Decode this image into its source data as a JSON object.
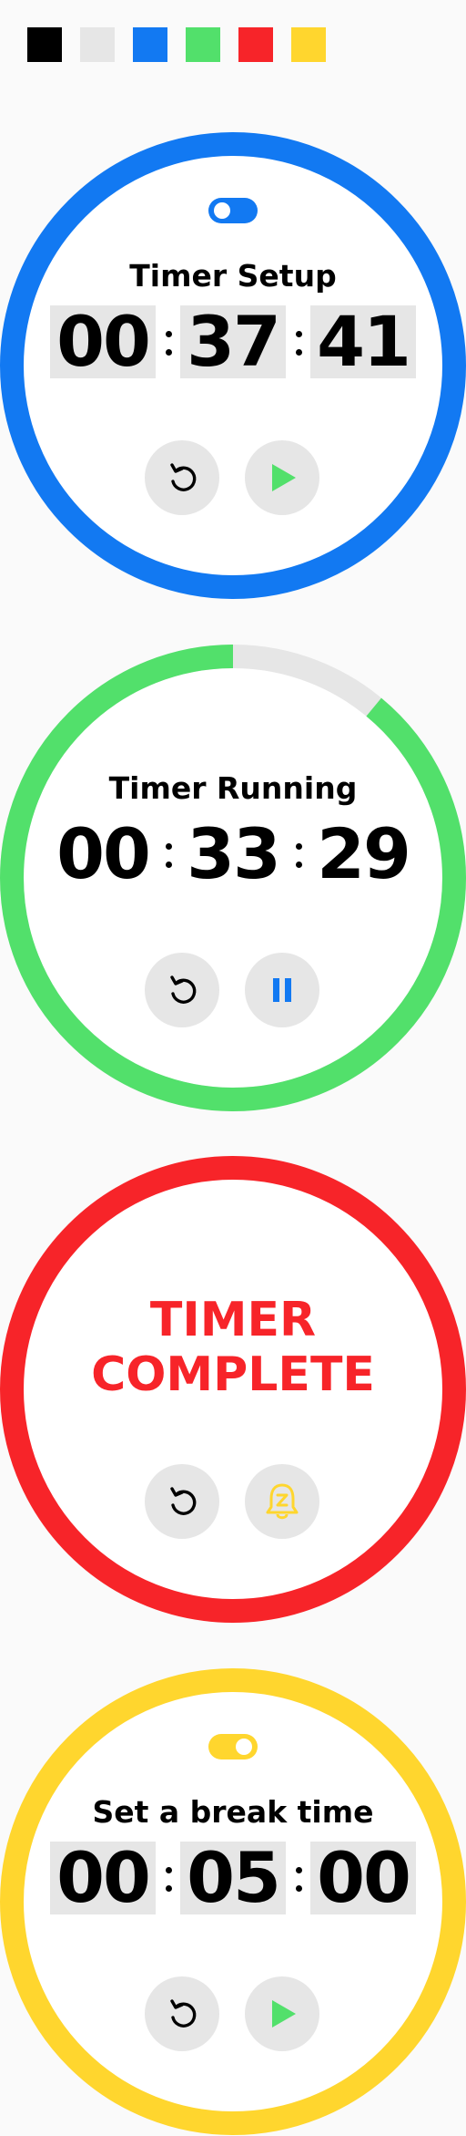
{
  "palette": {
    "black": "#000000",
    "light_gray": "#e6e6e6",
    "blue": "#1279f2",
    "green": "#52e06b",
    "red": "#f72429",
    "yellow": "#ffd62e"
  },
  "screens": [
    {
      "state": "setup",
      "title": "Timer Setup",
      "toggle_on": false,
      "hours": "00",
      "minutes": "37",
      "seconds": "41",
      "left_button_icon": "reset-icon",
      "right_button_icon": "play-icon"
    },
    {
      "state": "running",
      "title": "Timer Running",
      "hours": "00",
      "minutes": "33",
      "seconds": "29",
      "progress_remaining": 0.89,
      "left_button_icon": "reset-icon",
      "right_button_icon": "pause-icon"
    },
    {
      "state": "complete",
      "line1": "TIMER",
      "line2": "COMPLETE",
      "left_button_icon": "reset-icon",
      "right_button_icon": "snooze-bell-icon"
    },
    {
      "state": "break-setup",
      "title": "Set a break time",
      "toggle_on": true,
      "hours": "00",
      "minutes": "05",
      "seconds": "00",
      "left_button_icon": "reset-icon",
      "right_button_icon": "play-icon"
    }
  ]
}
